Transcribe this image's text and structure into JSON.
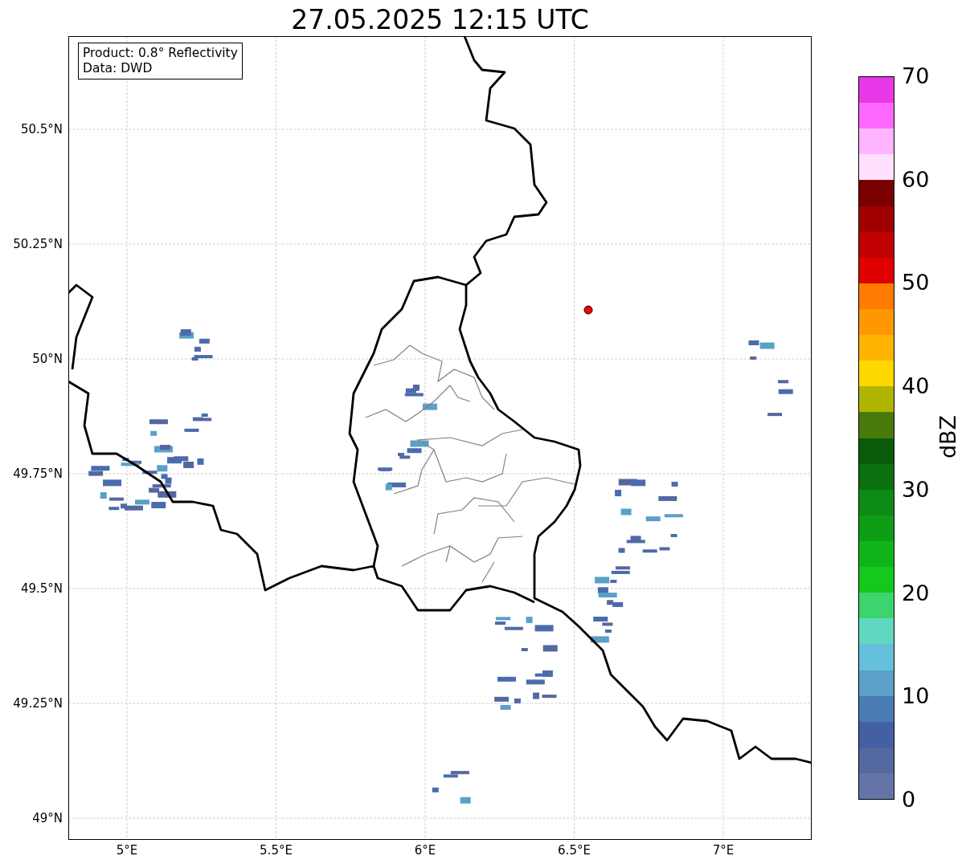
{
  "title": "27.05.2025 12:15 UTC",
  "info_box": [
    "Product: 0.8° Reflectivity",
    "Data: DWD"
  ],
  "map": {
    "lat_ticks": [
      "50.5°N",
      "50.25°N",
      "50°N",
      "49.75°N",
      "49.5°N",
      "49.25°N",
      "49°N"
    ],
    "lon_ticks": [
      "5°E",
      "5.5°E",
      "6°E",
      "6.5°E",
      "7°E"
    ]
  },
  "colorbar": {
    "label": "dBZ",
    "ticks": [
      "70",
      "60",
      "50",
      "40",
      "30",
      "20",
      "10",
      "0"
    ],
    "segments": [
      {
        "color": "#e838e8"
      },
      {
        "color": "#ff68ff"
      },
      {
        "color": "#ffb4ff"
      },
      {
        "color": "#ffe0ff"
      },
      {
        "color": "#7a0000"
      },
      {
        "color": "#a00000"
      },
      {
        "color": "#c00000"
      },
      {
        "color": "#e00000"
      },
      {
        "color": "#ff7c00"
      },
      {
        "color": "#ff9800"
      },
      {
        "color": "#ffb400"
      },
      {
        "color": "#ffd800"
      },
      {
        "color": "#b0b400"
      },
      {
        "color": "#487a0a"
      },
      {
        "color": "#0a5a0a"
      },
      {
        "color": "#0a7010"
      },
      {
        "color": "#0c8a14"
      },
      {
        "color": "#0e9e16"
      },
      {
        "color": "#10b418"
      },
      {
        "color": "#14c81c"
      },
      {
        "color": "#3cd46c"
      },
      {
        "color": "#60d8c0"
      },
      {
        "color": "#64c0dc"
      },
      {
        "color": "#5aa0c8"
      },
      {
        "color": "#4a7cb4"
      },
      {
        "color": "#4460a4"
      },
      {
        "color": "#5468a0"
      },
      {
        "color": "#6474a8"
      }
    ]
  }
}
